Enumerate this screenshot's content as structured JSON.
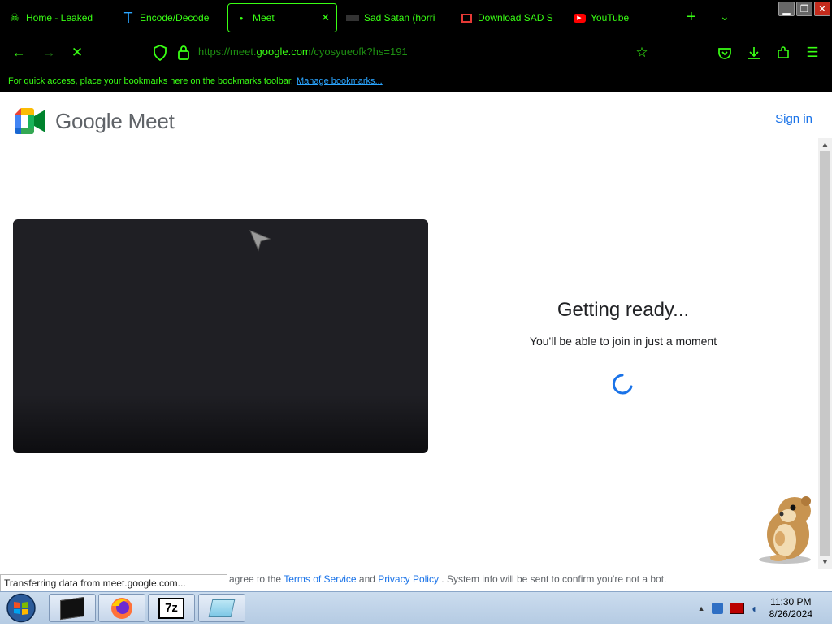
{
  "browser": {
    "tabs": [
      {
        "title": "Home - Leaked",
        "icon": "skull-icon"
      },
      {
        "title": "Encode/Decode",
        "icon": "t-letter-icon"
      },
      {
        "title": "Meet",
        "icon": "dot-icon"
      },
      {
        "title": "Sad Satan (horri",
        "icon": "black-bar-icon"
      },
      {
        "title": "Download SAD S",
        "icon": "download-site-icon"
      },
      {
        "title": "YouTube",
        "icon": "youtube-icon"
      }
    ],
    "url_prefix": "https://meet.",
    "url_domain": "google.com",
    "url_path": "/cyosyueofk?hs=191",
    "bookmarks_text": "For quick access, place your bookmarks here on the bookmarks toolbar.",
    "bookmarks_link": "Manage bookmarks..."
  },
  "page": {
    "logo_text": "Google Meet",
    "sign_in": "Sign in",
    "ready_title": "Getting ready...",
    "ready_subtitle": "You'll be able to join in just a moment",
    "footer": {
      "prefix": "agree to the",
      "terms": "Terms of Service",
      "and": "and",
      "privacy": "Privacy Policy",
      "suffix": ". System info will be sent to confirm you're not a bot."
    }
  },
  "status_bar": "Transferring data from meet.google.com...",
  "taskbar": {
    "apps": [
      "start-orb-icon",
      "terminal-icon",
      "firefox-icon",
      "7zip-icon",
      "notepad-icon"
    ],
    "time": "11:30 PM",
    "date": "8/26/2024"
  },
  "colors": {
    "accent": "#39ff14",
    "link": "#1a73e8"
  }
}
